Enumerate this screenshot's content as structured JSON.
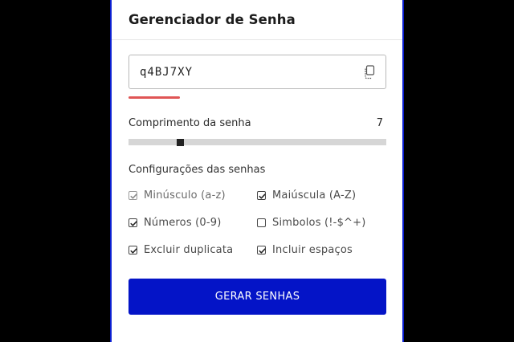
{
  "app": {
    "title": "Gerenciador de Senha"
  },
  "password": {
    "value": "q4BJ7XY",
    "copy_icon": "copy-icon",
    "strength_color": "#e05555"
  },
  "length": {
    "label": "Comprimento da senha",
    "value": "7",
    "slider_fraction": 0.2
  },
  "settings": {
    "heading": "Configurações das senhas",
    "options": [
      {
        "label": "Minúsculo (a-z)",
        "checked": true,
        "disabled": true
      },
      {
        "label": "Maiúscula (A-Z)",
        "checked": true,
        "disabled": false
      },
      {
        "label": "Números (0-9)",
        "checked": true,
        "disabled": false
      },
      {
        "label": "Simbolos (!-$^+)",
        "checked": false,
        "disabled": false
      },
      {
        "label": "Excluir duplicata",
        "checked": true,
        "disabled": false
      },
      {
        "label": "Incluir espaços",
        "checked": true,
        "disabled": false
      }
    ]
  },
  "actions": {
    "generate_label": "GERAR SENHAS"
  },
  "colors": {
    "accent": "#0414c7",
    "background": "#000000",
    "card_border": "#0b1fd0"
  }
}
